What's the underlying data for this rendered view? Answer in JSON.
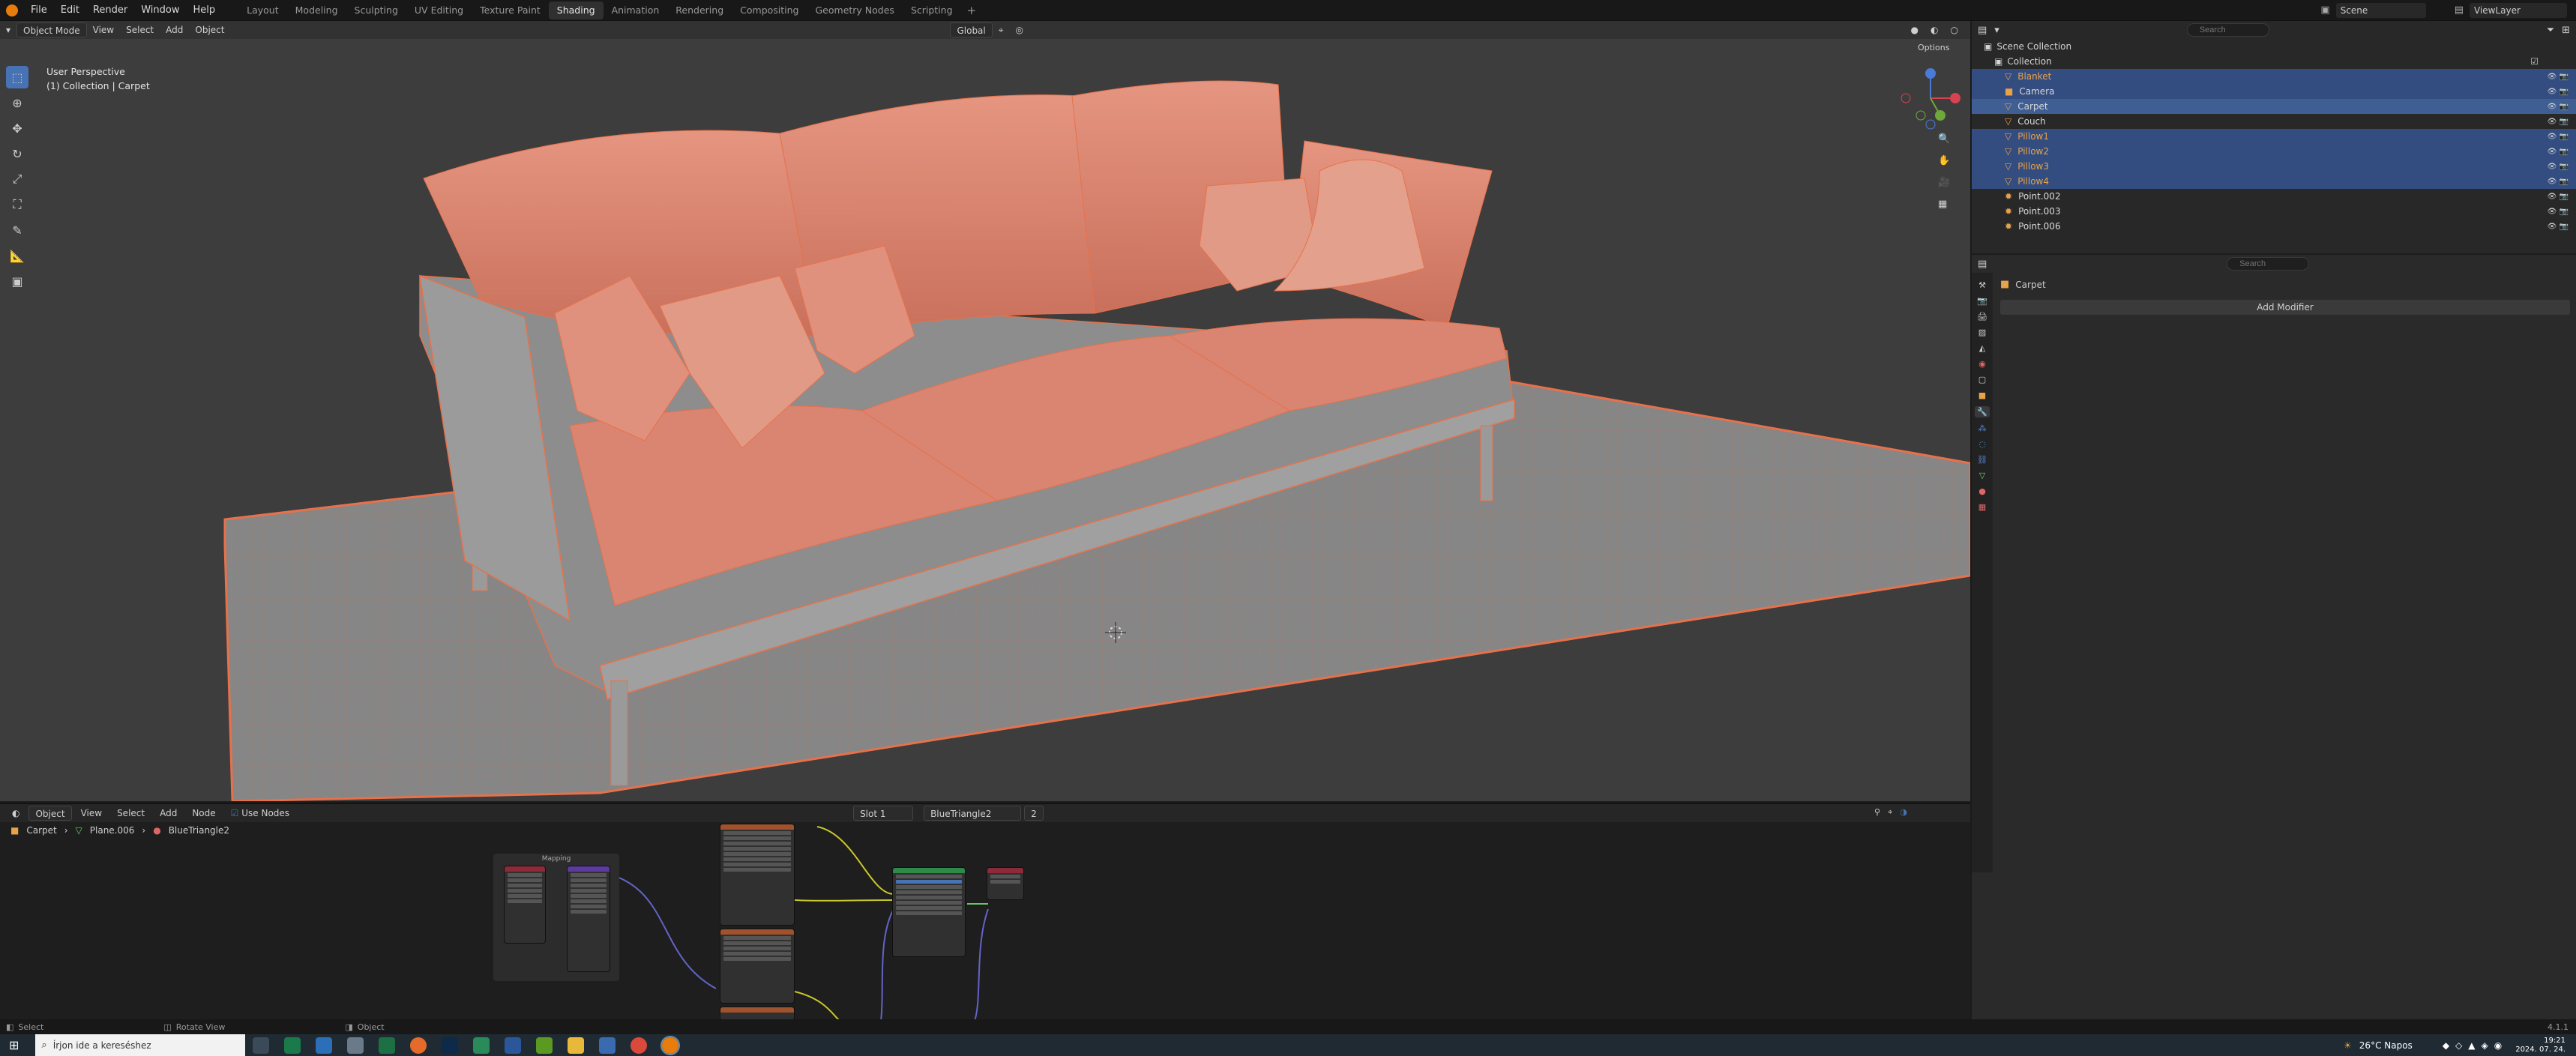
{
  "menu": {
    "file": "File",
    "edit": "Edit",
    "render": "Render",
    "window": "Window",
    "help": "Help"
  },
  "workspaces": [
    "Layout",
    "Modeling",
    "Sculpting",
    "UV Editing",
    "Texture Paint",
    "Shading",
    "Animation",
    "Rendering",
    "Compositing",
    "Geometry Nodes",
    "Scripting"
  ],
  "active_workspace": "Shading",
  "scene": {
    "scene_name": "Scene",
    "view_layer": "ViewLayer"
  },
  "viewport": {
    "mode": "Object Mode",
    "view": "View",
    "select": "Select",
    "add": "Add",
    "object": "Object",
    "orientation": "Global",
    "options": "Options",
    "overlay_line1": "User Perspective",
    "overlay_line2": "(1) Collection | Carpet"
  },
  "outliner": {
    "search_placeholder": "Search",
    "root": "Scene Collection",
    "collection": "Collection",
    "items": [
      {
        "name": "Blanket",
        "selected": true
      },
      {
        "name": "Camera",
        "selected": true
      },
      {
        "name": "Carpet",
        "selected": true,
        "active": true
      },
      {
        "name": "Couch",
        "selected": false
      },
      {
        "name": "Pillow1",
        "selected": true
      },
      {
        "name": "Pillow2",
        "selected": true
      },
      {
        "name": "Pillow3",
        "selected": true
      },
      {
        "name": "Pillow4",
        "selected": true
      },
      {
        "name": "Point.002",
        "selected": false
      },
      {
        "name": "Point.003",
        "selected": false
      },
      {
        "name": "Point.006",
        "selected": false
      }
    ]
  },
  "properties": {
    "search_placeholder": "Search",
    "object": "Carpet",
    "add_modifier": "Add Modifier"
  },
  "node_editor": {
    "object": "Object",
    "view": "View",
    "select": "Select",
    "add": "Add",
    "node": "Node",
    "use_nodes": "Use Nodes",
    "slot": "Slot 1",
    "material": "BlueTriangle2",
    "users": "2",
    "breadcrumb": [
      "Carpet",
      "Plane.006",
      "BlueTriangle2"
    ],
    "frame_label": "Mapping"
  },
  "status": {
    "select": "Select",
    "rotate": "Rotate View",
    "object": "Object",
    "version": "4.1.1"
  },
  "taskbar": {
    "search_placeholder": "Írjon ide a kereséshez",
    "weather": "26°C  Napos",
    "time": "19:21",
    "date": "2024. 07. 24."
  },
  "colors": {
    "accent": "#4772b3",
    "selection": "#334d80",
    "highlight_orange": "#e8714a"
  }
}
